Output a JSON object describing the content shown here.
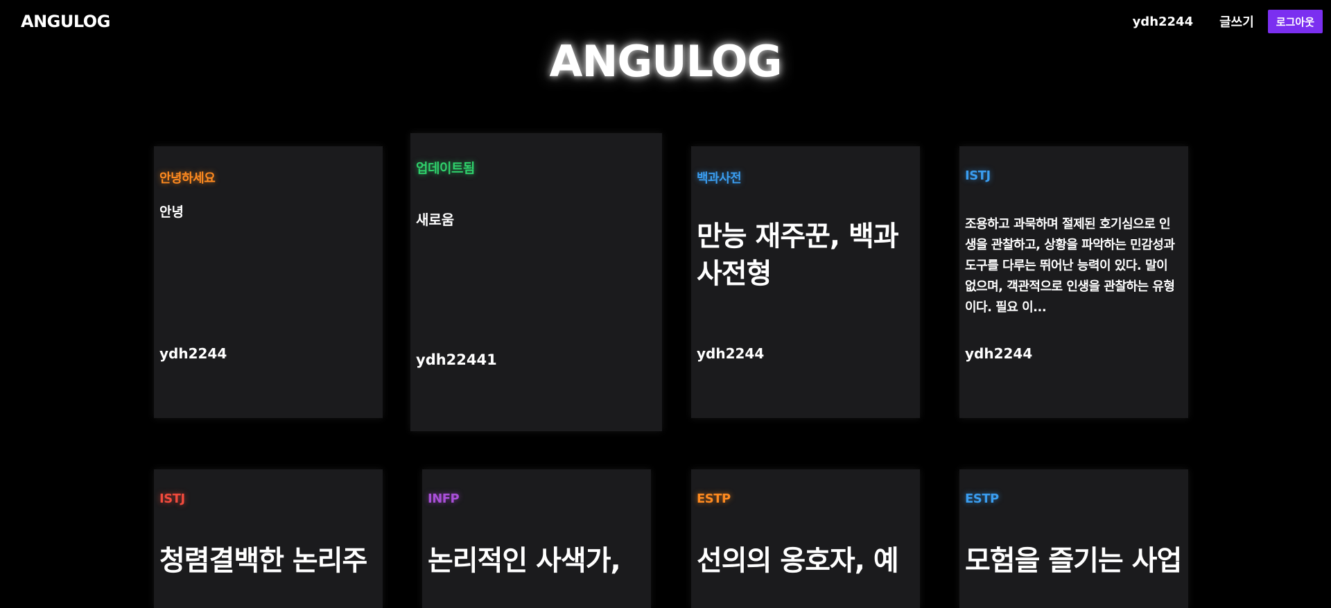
{
  "nav": {
    "logo": "ANGULOG",
    "user": "ydh2244",
    "write_label": "글쓰기",
    "logout_label": "로그아웃"
  },
  "hero": {
    "title": "ANGULOG"
  },
  "posts": [
    {
      "category": "안녕하세요",
      "category_color": "#ff8a1f",
      "body": "안녕",
      "author": "ydh2244"
    },
    {
      "category": "업데이트됨",
      "category_color": "#2fd06b",
      "body": "새로움",
      "author": "ydh22441"
    },
    {
      "category": "백과사전",
      "category_color": "#3a9df0",
      "body": "만능 재주꾼, 백과사전형",
      "author": "ydh2244"
    },
    {
      "category": "ISTJ",
      "category_color": "#3a9df0",
      "body": "조용하고 과묵하며 절제된 호기심으로 인생을 관찰하고, 상황을 파악하는 민감성과 도구를 다루는 뛰어난 능력이 있다. 말이 없으며, 객관적으로 인생을 관찰하는 유형이다. 필요 이...",
      "author": "ydh2244"
    },
    {
      "category": "ISTJ",
      "category_color": "#f24a3c",
      "body": "청렴결백한 논리주",
      "author": ""
    },
    {
      "category": "INFP",
      "category_color": "#a94fd8",
      "body": "논리적인 사색가,",
      "author": ""
    },
    {
      "category": "ESTP",
      "category_color": "#ff8a1f",
      "body": "선의의 옹호자, 예",
      "author": ""
    },
    {
      "category": "ESTP",
      "category_color": "#3a9df0",
      "body": "모험을 즐기는 사업",
      "author": ""
    }
  ]
}
